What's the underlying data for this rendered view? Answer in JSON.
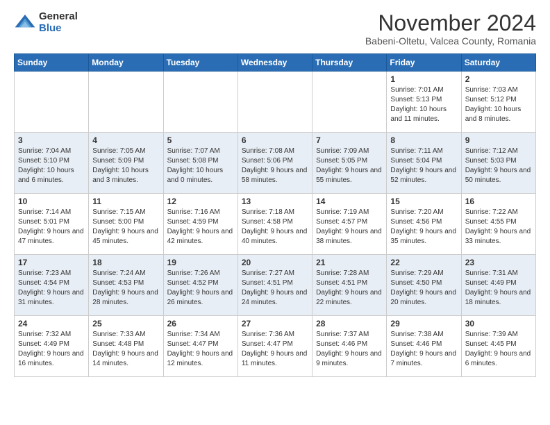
{
  "logo": {
    "general": "General",
    "blue": "Blue"
  },
  "header": {
    "month": "November 2024",
    "location": "Babeni-Oltetu, Valcea County, Romania"
  },
  "days_of_week": [
    "Sunday",
    "Monday",
    "Tuesday",
    "Wednesday",
    "Thursday",
    "Friday",
    "Saturday"
  ],
  "weeks": [
    [
      {
        "day": "",
        "info": ""
      },
      {
        "day": "",
        "info": ""
      },
      {
        "day": "",
        "info": ""
      },
      {
        "day": "",
        "info": ""
      },
      {
        "day": "",
        "info": ""
      },
      {
        "day": "1",
        "info": "Sunrise: 7:01 AM\nSunset: 5:13 PM\nDaylight: 10 hours and 11 minutes."
      },
      {
        "day": "2",
        "info": "Sunrise: 7:03 AM\nSunset: 5:12 PM\nDaylight: 10 hours and 8 minutes."
      }
    ],
    [
      {
        "day": "3",
        "info": "Sunrise: 7:04 AM\nSunset: 5:10 PM\nDaylight: 10 hours and 6 minutes."
      },
      {
        "day": "4",
        "info": "Sunrise: 7:05 AM\nSunset: 5:09 PM\nDaylight: 10 hours and 3 minutes."
      },
      {
        "day": "5",
        "info": "Sunrise: 7:07 AM\nSunset: 5:08 PM\nDaylight: 10 hours and 0 minutes."
      },
      {
        "day": "6",
        "info": "Sunrise: 7:08 AM\nSunset: 5:06 PM\nDaylight: 9 hours and 58 minutes."
      },
      {
        "day": "7",
        "info": "Sunrise: 7:09 AM\nSunset: 5:05 PM\nDaylight: 9 hours and 55 minutes."
      },
      {
        "day": "8",
        "info": "Sunrise: 7:11 AM\nSunset: 5:04 PM\nDaylight: 9 hours and 52 minutes."
      },
      {
        "day": "9",
        "info": "Sunrise: 7:12 AM\nSunset: 5:03 PM\nDaylight: 9 hours and 50 minutes."
      }
    ],
    [
      {
        "day": "10",
        "info": "Sunrise: 7:14 AM\nSunset: 5:01 PM\nDaylight: 9 hours and 47 minutes."
      },
      {
        "day": "11",
        "info": "Sunrise: 7:15 AM\nSunset: 5:00 PM\nDaylight: 9 hours and 45 minutes."
      },
      {
        "day": "12",
        "info": "Sunrise: 7:16 AM\nSunset: 4:59 PM\nDaylight: 9 hours and 42 minutes."
      },
      {
        "day": "13",
        "info": "Sunrise: 7:18 AM\nSunset: 4:58 PM\nDaylight: 9 hours and 40 minutes."
      },
      {
        "day": "14",
        "info": "Sunrise: 7:19 AM\nSunset: 4:57 PM\nDaylight: 9 hours and 38 minutes."
      },
      {
        "day": "15",
        "info": "Sunrise: 7:20 AM\nSunset: 4:56 PM\nDaylight: 9 hours and 35 minutes."
      },
      {
        "day": "16",
        "info": "Sunrise: 7:22 AM\nSunset: 4:55 PM\nDaylight: 9 hours and 33 minutes."
      }
    ],
    [
      {
        "day": "17",
        "info": "Sunrise: 7:23 AM\nSunset: 4:54 PM\nDaylight: 9 hours and 31 minutes."
      },
      {
        "day": "18",
        "info": "Sunrise: 7:24 AM\nSunset: 4:53 PM\nDaylight: 9 hours and 28 minutes."
      },
      {
        "day": "19",
        "info": "Sunrise: 7:26 AM\nSunset: 4:52 PM\nDaylight: 9 hours and 26 minutes."
      },
      {
        "day": "20",
        "info": "Sunrise: 7:27 AM\nSunset: 4:51 PM\nDaylight: 9 hours and 24 minutes."
      },
      {
        "day": "21",
        "info": "Sunrise: 7:28 AM\nSunset: 4:51 PM\nDaylight: 9 hours and 22 minutes."
      },
      {
        "day": "22",
        "info": "Sunrise: 7:29 AM\nSunset: 4:50 PM\nDaylight: 9 hours and 20 minutes."
      },
      {
        "day": "23",
        "info": "Sunrise: 7:31 AM\nSunset: 4:49 PM\nDaylight: 9 hours and 18 minutes."
      }
    ],
    [
      {
        "day": "24",
        "info": "Sunrise: 7:32 AM\nSunset: 4:49 PM\nDaylight: 9 hours and 16 minutes."
      },
      {
        "day": "25",
        "info": "Sunrise: 7:33 AM\nSunset: 4:48 PM\nDaylight: 9 hours and 14 minutes."
      },
      {
        "day": "26",
        "info": "Sunrise: 7:34 AM\nSunset: 4:47 PM\nDaylight: 9 hours and 12 minutes."
      },
      {
        "day": "27",
        "info": "Sunrise: 7:36 AM\nSunset: 4:47 PM\nDaylight: 9 hours and 11 minutes."
      },
      {
        "day": "28",
        "info": "Sunrise: 7:37 AM\nSunset: 4:46 PM\nDaylight: 9 hours and 9 minutes."
      },
      {
        "day": "29",
        "info": "Sunrise: 7:38 AM\nSunset: 4:46 PM\nDaylight: 9 hours and 7 minutes."
      },
      {
        "day": "30",
        "info": "Sunrise: 7:39 AM\nSunset: 4:45 PM\nDaylight: 9 hours and 6 minutes."
      }
    ]
  ]
}
